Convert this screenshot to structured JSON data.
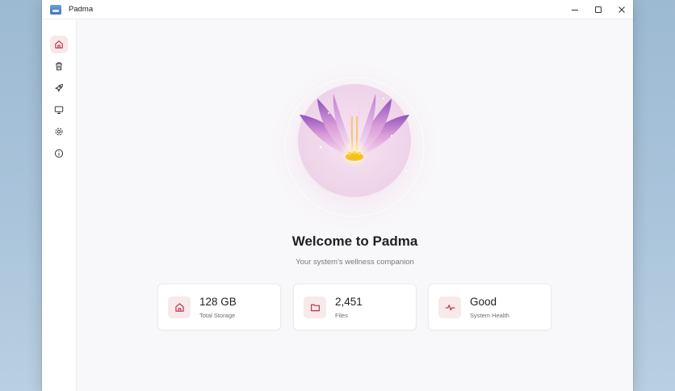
{
  "window": {
    "title": "Padma",
    "controls": [
      "minimize-icon",
      "maximize-icon",
      "close-icon"
    ]
  },
  "sidebar": {
    "items": [
      {
        "name": "home",
        "icon": "home-icon",
        "active": true
      },
      {
        "name": "cleanup",
        "icon": "trash-icon",
        "active": false
      },
      {
        "name": "optimize",
        "icon": "rocket-icon",
        "active": false
      },
      {
        "name": "system",
        "icon": "monitor-icon",
        "active": false
      },
      {
        "name": "settings",
        "icon": "gear-icon",
        "active": false
      },
      {
        "name": "about",
        "icon": "info-icon",
        "active": false
      }
    ]
  },
  "main": {
    "hero_icon": "lotus-icon",
    "welcome": "Welcome to Padma",
    "subtitle": "Your system's wellness companion",
    "cards": [
      {
        "icon": "home-icon",
        "value": "128 GB",
        "label": "Total Storage"
      },
      {
        "icon": "folder-icon",
        "value": "2,451",
        "label": "Files"
      },
      {
        "icon": "pulse-icon",
        "value": "Good",
        "label": "System Health"
      }
    ]
  },
  "colors": {
    "accent": "#b2334b",
    "accent_soft": "#f8e8ea",
    "petal_purple": "#9b63c8",
    "petal_pink": "#e6b6de",
    "lotus_center": "#f5c21a"
  }
}
